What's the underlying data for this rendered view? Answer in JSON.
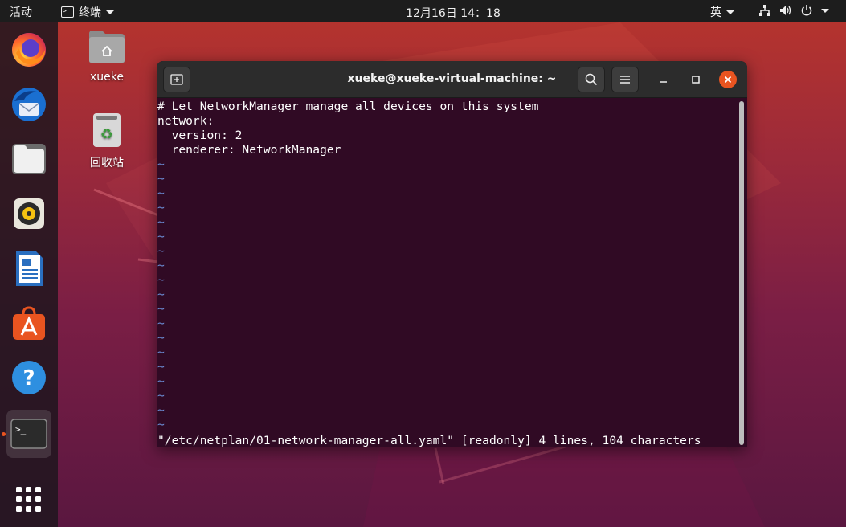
{
  "topbar": {
    "activities": "活动",
    "app_menu_label": "终端",
    "clock": "12月16日  14：18",
    "input_method": "英"
  },
  "desktop": {
    "icons": [
      {
        "label": "xueke",
        "icon": "home-folder-icon"
      },
      {
        "label": "回收站",
        "icon": "trash-icon"
      }
    ]
  },
  "dock": {
    "items": [
      {
        "name": "firefox-icon"
      },
      {
        "name": "thunderbird-icon"
      },
      {
        "name": "files-icon"
      },
      {
        "name": "rhythmbox-icon"
      },
      {
        "name": "libreoffice-writer-icon"
      },
      {
        "name": "ubuntu-software-icon"
      },
      {
        "name": "help-icon"
      },
      {
        "name": "terminal-icon",
        "active": true
      },
      {
        "name": "show-applications-icon"
      }
    ]
  },
  "terminal": {
    "title": "xueke@xueke-virtual-machine: ~",
    "lines": [
      "# Let NetworkManager manage all devices on this system",
      "network:",
      "  version: 2",
      "  renderer: NetworkManager"
    ],
    "tilde": "~",
    "status": "\"/etc/netplan/01-network-manager-all.yaml\" [readonly] 4 lines, 104 characters"
  },
  "colors": {
    "accent": "#e95420",
    "terminal_bg": "#300a24",
    "tilde": "#6c8cd5"
  }
}
